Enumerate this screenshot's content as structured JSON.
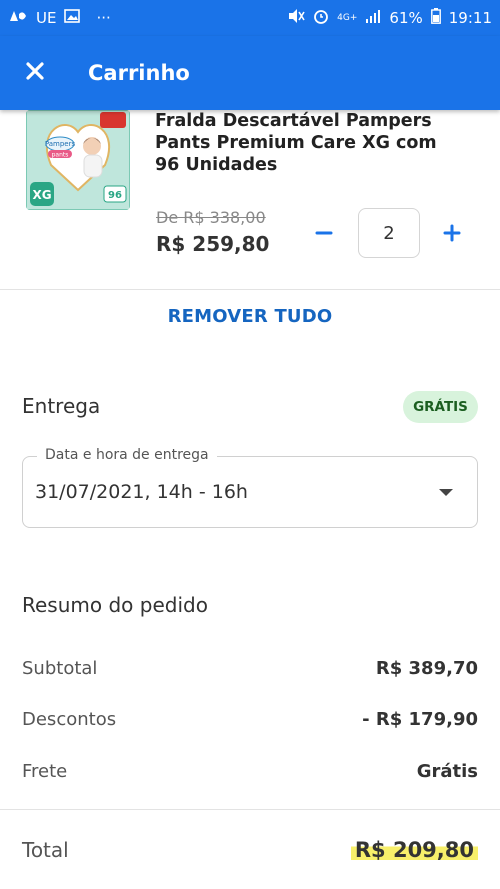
{
  "statusbar": {
    "carrier": "UE",
    "dots": "···",
    "network": "4G+",
    "battery": "61%",
    "time": "19:11"
  },
  "appbar": {
    "title": "Carrinho",
    "close_icon": "close-icon"
  },
  "product": {
    "name": "Fralda Descartável Pampers Pants Premium Care XG com 96 Unidades",
    "old_price_prefix": "De ",
    "old_price": "R$ 338,00",
    "price": "R$ 259,80",
    "quantity": "2",
    "minus_icon": "minus-icon",
    "plus_icon": "plus-icon",
    "image": {
      "brand": "Pampers",
      "subbrand": "pants",
      "size": "XG",
      "count": "96"
    }
  },
  "actions": {
    "remove_all": "REMOVER TUDO"
  },
  "delivery": {
    "title": "Entrega",
    "badge": "GRÁTIS",
    "field_label": "Data e hora de entrega",
    "field_value": "31/07/2021, 14h - 16h"
  },
  "summary": {
    "title": "Resumo do pedido",
    "rows": [
      {
        "label": "Subtotal",
        "value": "R$ 389,70"
      },
      {
        "label": "Descontos",
        "value": "- R$ 179,90"
      },
      {
        "label": "Frete",
        "value": "Grátis"
      }
    ],
    "total_label": "Total",
    "total_value": "R$ 209,80"
  },
  "colors": {
    "primary": "#1a73e8",
    "link": "#1565c0",
    "badge_bg": "#d8f3dc",
    "badge_text": "#1b5e20",
    "highlight": "#f7ef6a"
  }
}
